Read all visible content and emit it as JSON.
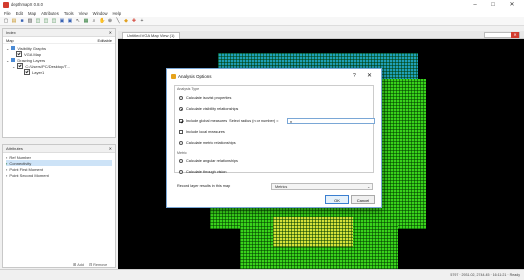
{
  "app": {
    "title": "depthmapX 0.8.0",
    "window_controls": {
      "minimize": "–",
      "maximize": "□",
      "close": "✕"
    }
  },
  "menu": [
    "File",
    "Edit",
    "Map",
    "Attributes",
    "Tools",
    "View",
    "Window",
    "Help"
  ],
  "toolbar": {
    "icons": [
      "new-file-icon",
      "open-folder-icon",
      "save-icon",
      "print-icon",
      "chart-icon",
      "chart-icon",
      "chart-icon",
      "image-icon",
      "image-icon",
      "select-arrow-icon",
      "grid-icon",
      "binoculars-icon",
      "pan-icon",
      "zoom-icon",
      "line-icon",
      "fill-icon",
      "axial-icon",
      "plus-icon"
    ],
    "glyphs": [
      "▢",
      "▤",
      "■",
      "▥",
      "◫",
      "◫",
      "◫",
      "▣",
      "▣",
      "↖",
      "▦",
      "⌕",
      "✋",
      "⊕",
      "╲",
      "◆",
      "✚",
      "+"
    ]
  },
  "index_panel": {
    "title": "Index",
    "col_map": "Map",
    "col_editable": "Editable",
    "tree": [
      {
        "label": "Visibility Graphs",
        "level": 0,
        "checked": false
      },
      {
        "label": "VGA Map",
        "level": 1,
        "checked": true
      },
      {
        "label": "Drawing Layers",
        "level": 0,
        "checked": false
      },
      {
        "label": "C:/Users/PC/Desktop/T...",
        "level": 1,
        "checked": true
      },
      {
        "label": "Layer1",
        "level": 2,
        "checked": true
      }
    ]
  },
  "attributes_panel": {
    "title": "Attributes",
    "items": [
      "Ref Number",
      "Connectivity",
      "Point First Moment",
      "Point Second Moment"
    ],
    "selected_index": 1,
    "footer_add": "Add",
    "footer_remove": "Remove"
  },
  "map_view": {
    "tab_label": "Untitled:VGA Map View (1)"
  },
  "status_bar": {
    "text": "5797 · 2931.02, 2744.45 · 16:11:21 · Ready"
  },
  "dialog": {
    "title": "Analysis Options",
    "help": "?",
    "close": "✕",
    "analysis_type_label": "Analysis Type",
    "options": [
      {
        "label": "Calculate isovist properties",
        "selected": false
      },
      {
        "label": "Calculate visibility relationships",
        "selected": true
      }
    ],
    "global_measures_label": "Include global measures",
    "radius_label": "Select radius (n or number) =",
    "radius_value": "n",
    "local_measures_label": "Include local measures",
    "metric_label": "Calculate metric relationships",
    "agent_section_label": "Metric",
    "agent_option_1": "Calculate angular relationships",
    "agent_option_2": "Calculate through vision",
    "layer_label": "Record layer results in this map",
    "layer_value": "Metrics",
    "ok_label": "OK",
    "cancel_label": "Cancel"
  }
}
